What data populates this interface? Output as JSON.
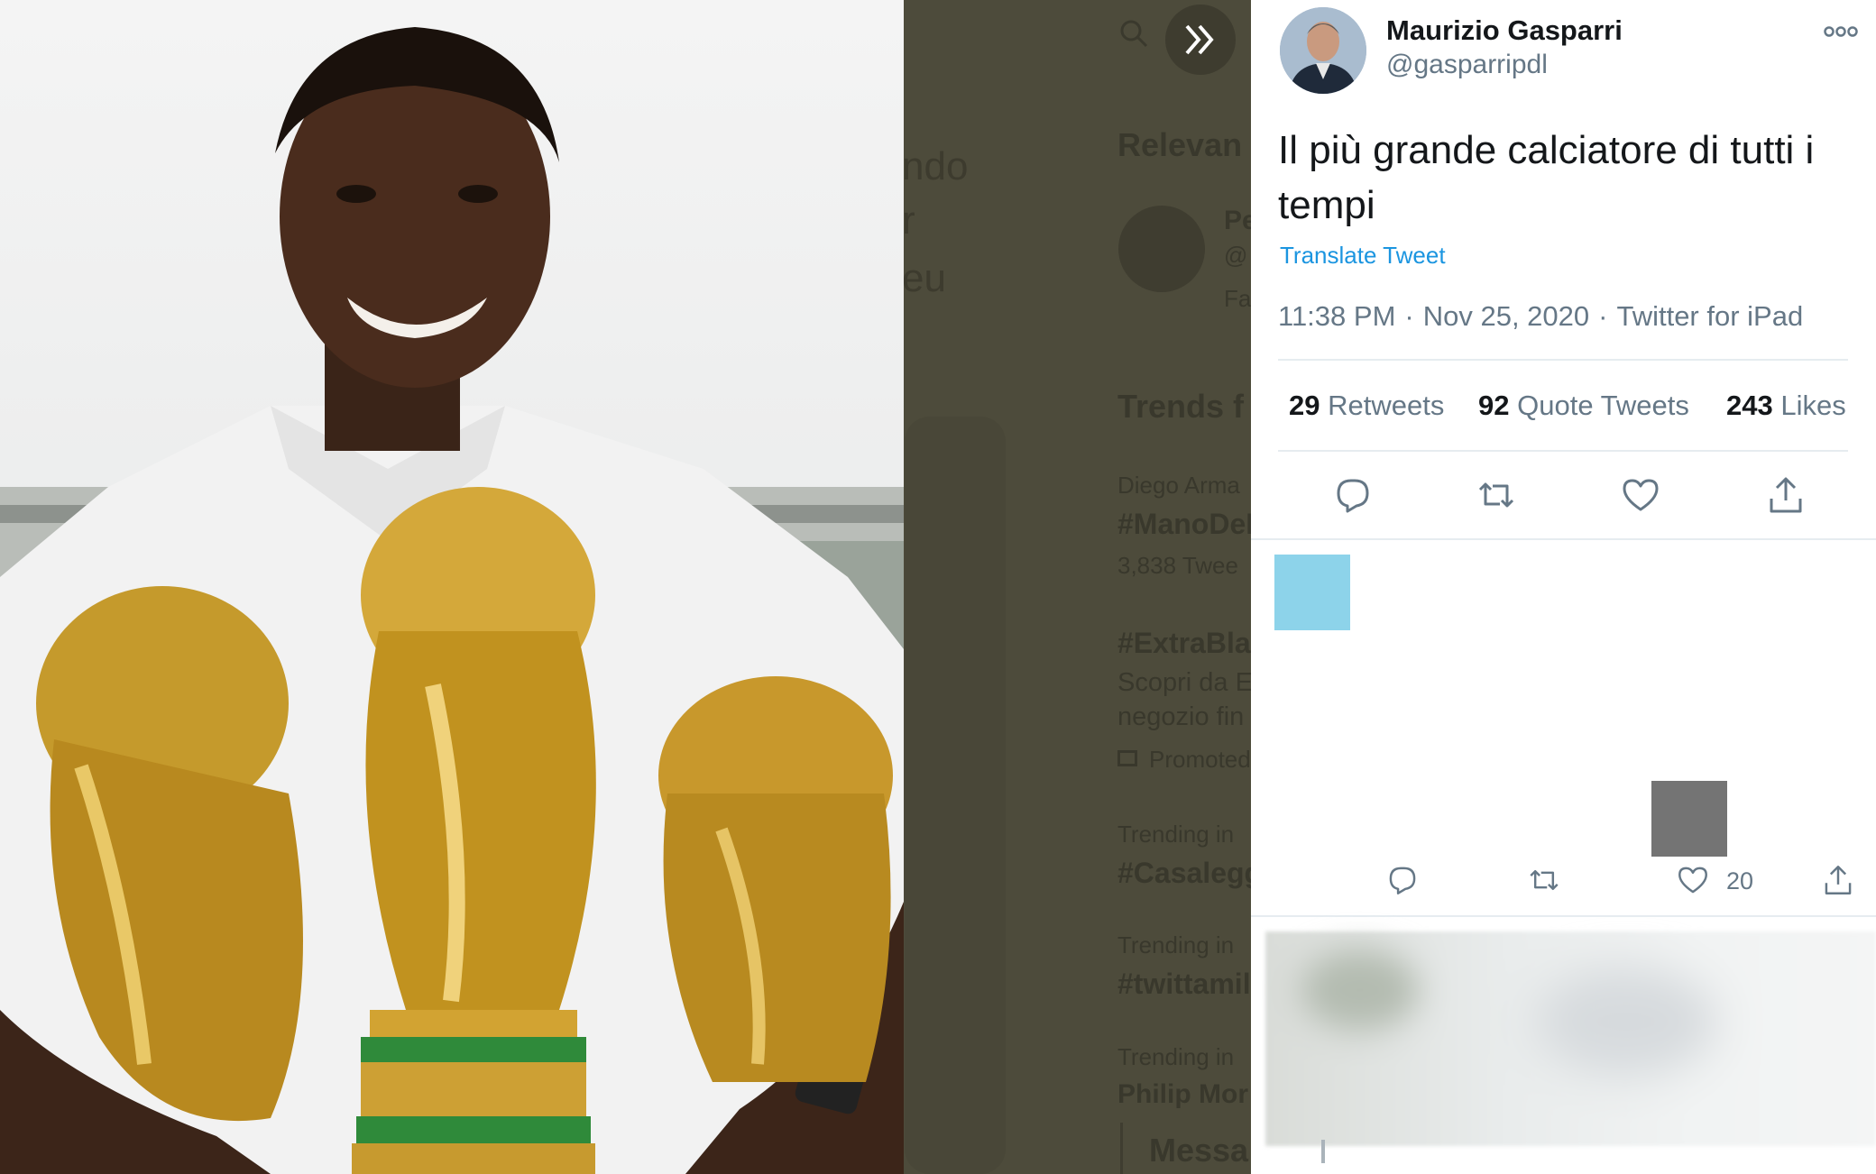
{
  "sidebar_behind": {
    "heading_relevant": "Relevan",
    "fragment_1": "ndo",
    "fragment_2": "r",
    "fragment_3": "eu",
    "account_name": "Pe",
    "account_handle": "@",
    "account_line3": "Fa",
    "heading_trends": "Trends f",
    "trends": [
      {
        "context": "Diego Arma",
        "name": "#ManoDeD",
        "count": "3,838 Twee"
      },
      {
        "context": "",
        "name": "#ExtraBla",
        "line1": "Scopri da E",
        "line2": "negozio fin",
        "promoted": "Promoted"
      },
      {
        "context": "Trending in",
        "name": "#Casalegg"
      },
      {
        "context": "Trending in",
        "name": "#twittamil"
      },
      {
        "context": "Trending in",
        "name": "Philip Mor"
      }
    ],
    "messages": "Messa"
  },
  "tweet": {
    "author_name": "Maurizio Gasparri",
    "author_handle": "@gasparripdl",
    "text": "Il più grande calciatore di tutti i tempi",
    "translate_label": "Translate Tweet",
    "time": "11:38 PM",
    "date": "Nov 25, 2020",
    "source": "Twitter for iPad",
    "dot": "·",
    "retweets_count": "29",
    "retweets_label": "Retweets",
    "quotes_count": "92",
    "quotes_label": "Quote Tweets",
    "likes_count": "243",
    "likes_label": "Likes"
  },
  "reply_row": {
    "like_count": "20"
  },
  "icons": [
    "expand-chevrons-icon",
    "search-icon",
    "more-icon",
    "reply-icon",
    "retweet-icon",
    "like-icon",
    "share-icon"
  ],
  "colors": {
    "link": "#1b95e0",
    "text_primary": "#14171a",
    "text_secondary": "#657786",
    "dim_overlay": "#4d4b3b",
    "blue_square": "#8dd3ea",
    "gray_square": "#747474"
  }
}
